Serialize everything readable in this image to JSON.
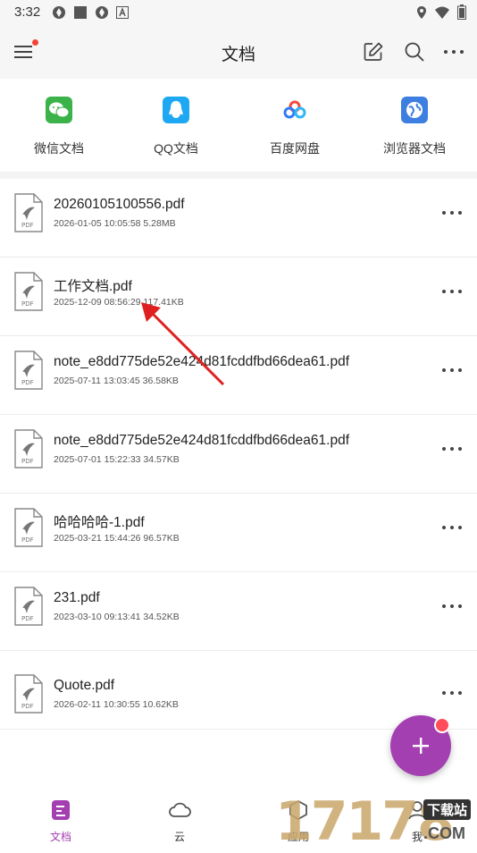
{
  "status_bar": {
    "time": "3:32"
  },
  "header": {
    "title": "文档"
  },
  "shortcuts": [
    {
      "label": "微信文档",
      "icon": "wechat-icon",
      "color": "#3bb34a"
    },
    {
      "label": "QQ文档",
      "icon": "qq-icon",
      "color": "#1ea7f2"
    },
    {
      "label": "百度网盘",
      "icon": "baidu-netdisk-icon",
      "color": "#2f7cf6"
    },
    {
      "label": "浏览器文档",
      "icon": "browser-icon",
      "color": "#3d7fe0"
    }
  ],
  "files": [
    {
      "name": "20260105100556.pdf",
      "date": "2026-01-05 10:05:58",
      "size": "5.28MB",
      "type": "PDF"
    },
    {
      "name": "工作文档.pdf",
      "date": "2025-12-09 08:56:29",
      "size": "117.41KB",
      "type": "PDF"
    },
    {
      "name": "note_e8dd775de52e424d81fcddfbd66dea61.pdf",
      "date": "2025-07-11 13:03:45",
      "size": "36.58KB",
      "type": "PDF"
    },
    {
      "name": "note_e8dd775de52e424d81fcddfbd66dea61.pdf",
      "date": "2025-07-01 15:22:33",
      "size": "34.57KB",
      "type": "PDF"
    },
    {
      "name": "哈哈哈哈-1.pdf",
      "date": "2025-03-21 15:44:26",
      "size": "96.57KB",
      "type": "PDF"
    },
    {
      "name": "231.pdf",
      "date": "2023-03-10 09:13:41",
      "size": "34.52KB",
      "type": "PDF"
    },
    {
      "name": "Quote.pdf",
      "date": "2026-02-11 10:30:55",
      "size": "10.62KB",
      "type": "PDF"
    }
  ],
  "bottom_nav": [
    {
      "label": "文档",
      "icon": "document-icon",
      "active": true
    },
    {
      "label": "云",
      "icon": "cloud-icon",
      "active": false
    },
    {
      "label": "应用",
      "icon": "apps-icon",
      "active": false
    },
    {
      "label": "我",
      "icon": "profile-icon",
      "active": false
    }
  ],
  "watermark": {
    "text": "17178",
    "sub": "下载站",
    "domain": ".COM"
  },
  "colors": {
    "accent": "#a43fb1",
    "badge": "#f44336",
    "arrow": "#e02020"
  }
}
